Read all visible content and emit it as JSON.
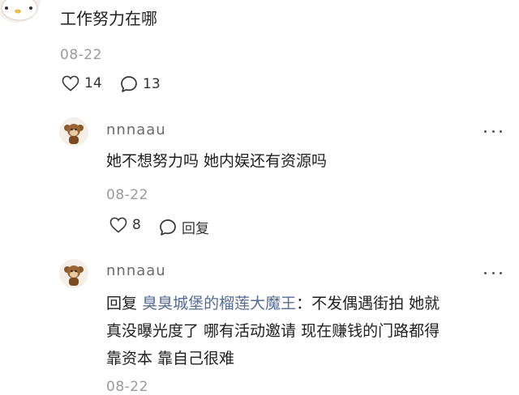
{
  "top_comment": {
    "text": "工作努力在哪",
    "date": "08-22",
    "likes": "14",
    "comments": "13"
  },
  "replies": [
    {
      "username": "nnnaau",
      "text": "她不想努力吗 她内娱还有资源吗",
      "date": "08-22",
      "likes": "8",
      "reply_label": "回复"
    },
    {
      "username": "nnnaau",
      "reply_prefix": "回复",
      "mention": "臭臭城堡的榴莲大魔王",
      "line1_rest": "：不发偶遇街拍 她就",
      "line2": "真没曝光度了 哪有活动邀请 现在赚钱的门路都得",
      "line3": "靠资本 靠自己很难",
      "date": "08-22"
    }
  ],
  "colors": {
    "mention": "#576b95",
    "date": "#9a9a9a",
    "username": "#6b6b6b"
  },
  "icons": {
    "like": "heart-outline-icon",
    "comment": "speech-bubble-icon",
    "more": "ellipsis-icon"
  }
}
